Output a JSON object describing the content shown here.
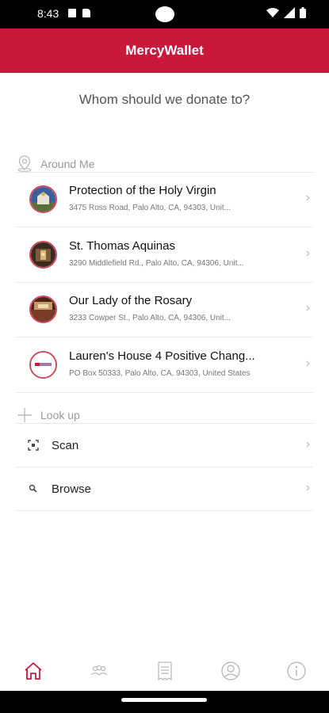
{
  "status_bar": {
    "time": "8:43"
  },
  "app_bar": {
    "title": "MercyWallet"
  },
  "prompt": "Whom should we donate to?",
  "around_me": {
    "label": "Around Me",
    "places": [
      {
        "name": "Protection of the Holy Virgin",
        "address": "3475 Ross Road, Palo Alto, CA, 94303, Unit..."
      },
      {
        "name": "St. Thomas Aquinas",
        "address": "3290 Middlefield Rd., Palo Alto, CA, 94306, Unit..."
      },
      {
        "name": "Our Lady of the Rosary",
        "address": "3233 Cowper St., Palo Alto, CA, 94306, Unit..."
      },
      {
        "name": "Lauren's House 4 Positive Chang...",
        "address": "PO Box 50333, Palo Alto, CA, 94303, United States"
      }
    ]
  },
  "look_up": {
    "label": "Look up",
    "items": [
      {
        "label": "Scan"
      },
      {
        "label": "Browse"
      }
    ]
  },
  "bottom_nav": {
    "items": [
      "home-icon",
      "groups-icon",
      "receipt-icon",
      "profile-icon",
      "info-icon"
    ],
    "active_index": 0
  },
  "colors": {
    "brand": "#c8193c",
    "text": "#222222",
    "muted": "#999999"
  }
}
